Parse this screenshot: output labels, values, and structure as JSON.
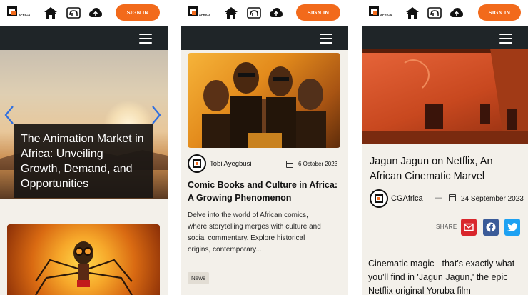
{
  "header": {
    "logo_text": "AFRICA",
    "sign_in_label": "SIGN IN",
    "icons": [
      "hut-icon",
      "elephant-icon",
      "cloud-upload-icon",
      "menu-icon"
    ]
  },
  "panel1": {
    "hero_title": "The Animation Market in Africa: Unveiling Growth, Demand, and Opportunities"
  },
  "panel2": {
    "author": "Tobi Ayegbusi",
    "date": "6 October 2023",
    "title": "Comic Books and Culture in Africa: A Growing Phenomenon",
    "excerpt": "Delve into the world of African comics, where storytelling merges with culture and social commentary. Explore historical origins, contemporary...",
    "tag": "News"
  },
  "panel3": {
    "title": "Jagun Jagun on Netflix, An African Cinematic Marvel",
    "author": "CGAfrica",
    "separator": "—",
    "date": "24 September 2023",
    "share_label": "SHARE",
    "body": "Cinematic magic - that's exactly what you'll find in 'Jagun Jagun,' the epic Netflix original Yoruba film"
  },
  "colors": {
    "accent": "#f26a1b",
    "dark_bar": "#1f2528",
    "background": "#f3f0ea",
    "email_share": "#d9262c",
    "facebook_share": "#3b5b98",
    "twitter_share": "#1da1f2"
  }
}
